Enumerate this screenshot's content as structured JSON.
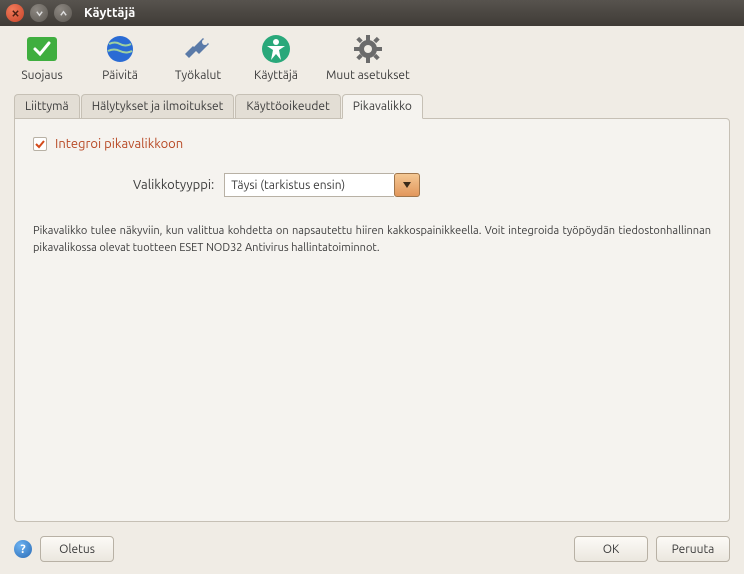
{
  "window": {
    "title": "Käyttäjä"
  },
  "toolbar": {
    "items": [
      {
        "label": "Suojaus"
      },
      {
        "label": "Päivitä"
      },
      {
        "label": "Työkalut"
      },
      {
        "label": "Käyttäjä"
      },
      {
        "label": "Muut asetukset"
      }
    ]
  },
  "tabs": [
    {
      "label": "Liittymä"
    },
    {
      "label": "Hälytykset ja ilmoitukset"
    },
    {
      "label": "Käyttöoikeudet"
    },
    {
      "label": "Pikavalikko"
    }
  ],
  "panel": {
    "checkbox_label": "Integroi pikavalikkoon",
    "menu_type_label": "Valikkotyyppi:",
    "menu_type_value": "Täysi (tarkistus ensin)",
    "description": "Pikavalikko tulee näkyviin, kun valittua kohdetta on napsautettu hiiren kakkospainikkeella. Voit integroida työpöydän tiedostonhallinnan pikavalikossa olevat tuotteen ESET NOD32 Antivirus hallintatoiminnot."
  },
  "buttons": {
    "default": "Oletus",
    "ok": "OK",
    "cancel": "Peruuta"
  }
}
